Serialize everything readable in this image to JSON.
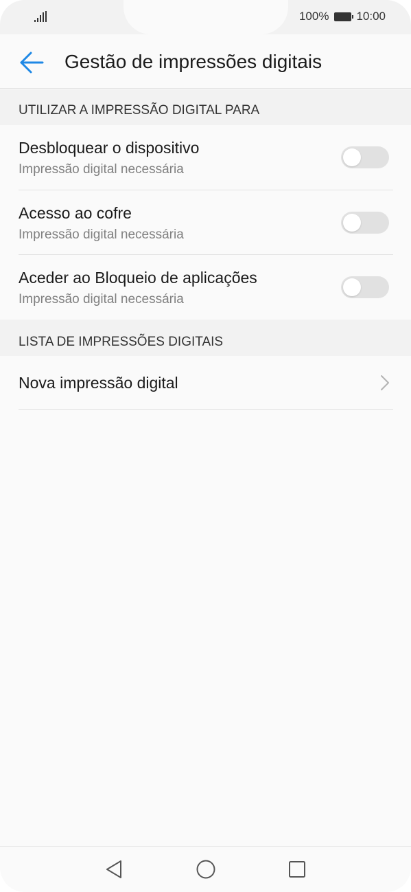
{
  "status_bar": {
    "battery_percent": "100%",
    "time": "10:00",
    "icons": [
      "signal-icon",
      "battery-icon"
    ]
  },
  "header": {
    "title": "Gestão de impressões digitais",
    "back_icon": "arrow-left-icon",
    "accent_color": "#1e88e5"
  },
  "sections": [
    {
      "header": "UTILIZAR A IMPRESSÃO DIGITAL PARA",
      "items": [
        {
          "title": "Desbloquear o dispositivo",
          "subtitle": "Impressão digital necessária",
          "toggle": "off"
        },
        {
          "title": "Acesso ao cofre",
          "subtitle": "Impressão digital necessária",
          "toggle": "off"
        },
        {
          "title": "Aceder ao Bloqueio de aplicações",
          "subtitle": "Impressão digital necessária",
          "toggle": "off"
        }
      ]
    },
    {
      "header": "LISTA DE IMPRESSÕES DIGITAIS",
      "items": [
        {
          "title": "Nova impressão digital",
          "icon": "chevron-right-icon"
        }
      ]
    }
  ],
  "nav_bar": {
    "icons": [
      "back-triangle-icon",
      "home-circle-icon",
      "recents-square-icon"
    ]
  }
}
